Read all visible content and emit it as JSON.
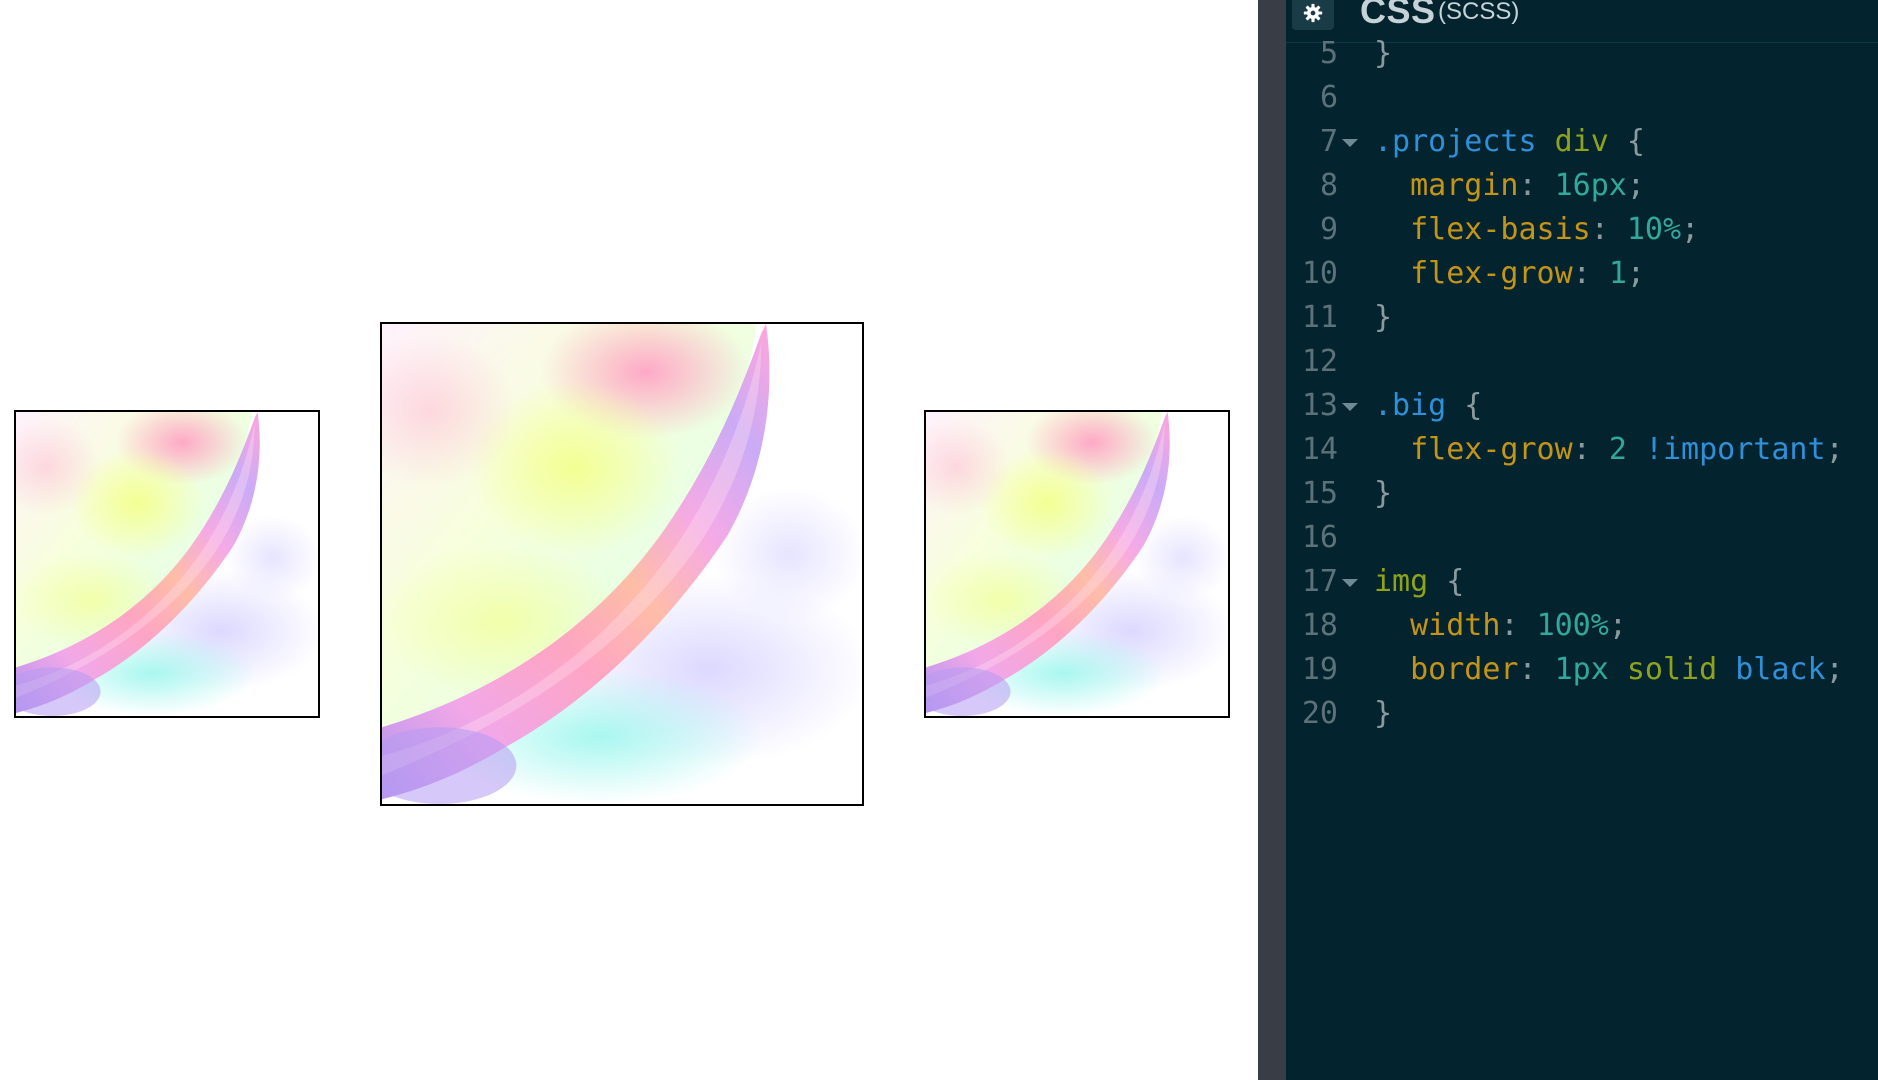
{
  "editor": {
    "language": "CSS",
    "preprocessor": "(SCSS)",
    "settings_icon": "gear-icon",
    "lines": [
      {
        "n": "5",
        "fold": false,
        "tokens": [
          [
            "punct",
            "}"
          ]
        ]
      },
      {
        "n": "6",
        "fold": false,
        "tokens": []
      },
      {
        "n": "7",
        "fold": true,
        "tokens": [
          [
            "sel",
            ".projects"
          ],
          [
            "punct",
            " "
          ],
          [
            "tag",
            "div"
          ],
          [
            "punct",
            " {"
          ]
        ]
      },
      {
        "n": "8",
        "fold": false,
        "tokens": [
          [
            "punct",
            "  "
          ],
          [
            "prop",
            "margin"
          ],
          [
            "punct",
            ": "
          ],
          [
            "num",
            "16px"
          ],
          [
            "punct",
            ";"
          ]
        ]
      },
      {
        "n": "9",
        "fold": false,
        "tokens": [
          [
            "punct",
            "  "
          ],
          [
            "prop",
            "flex-basis"
          ],
          [
            "punct",
            ": "
          ],
          [
            "num",
            "10%"
          ],
          [
            "punct",
            ";"
          ]
        ]
      },
      {
        "n": "10",
        "fold": false,
        "tokens": [
          [
            "punct",
            "  "
          ],
          [
            "prop",
            "flex-grow"
          ],
          [
            "punct",
            ": "
          ],
          [
            "num",
            "1"
          ],
          [
            "punct",
            ";"
          ]
        ]
      },
      {
        "n": "11",
        "fold": false,
        "tokens": [
          [
            "punct",
            "}"
          ]
        ]
      },
      {
        "n": "12",
        "fold": false,
        "tokens": []
      },
      {
        "n": "13",
        "fold": true,
        "tokens": [
          [
            "sel",
            ".big"
          ],
          [
            "punct",
            " {"
          ]
        ]
      },
      {
        "n": "14",
        "fold": false,
        "tokens": [
          [
            "punct",
            "  "
          ],
          [
            "prop",
            "flex-grow"
          ],
          [
            "punct",
            ": "
          ],
          [
            "num",
            "2"
          ],
          [
            "punct",
            " "
          ],
          [
            "imp",
            "!important"
          ],
          [
            "punct",
            ";"
          ]
        ]
      },
      {
        "n": "15",
        "fold": false,
        "tokens": [
          [
            "punct",
            "}"
          ]
        ]
      },
      {
        "n": "16",
        "fold": false,
        "tokens": []
      },
      {
        "n": "17",
        "fold": true,
        "tokens": [
          [
            "tag",
            "img"
          ],
          [
            "punct",
            " {"
          ]
        ]
      },
      {
        "n": "18",
        "fold": false,
        "tokens": [
          [
            "punct",
            "  "
          ],
          [
            "prop",
            "width"
          ],
          [
            "punct",
            ": "
          ],
          [
            "num",
            "100%"
          ],
          [
            "punct",
            ";"
          ]
        ]
      },
      {
        "n": "19",
        "fold": false,
        "tokens": [
          [
            "punct",
            "  "
          ],
          [
            "prop",
            "border"
          ],
          [
            "punct",
            ": "
          ],
          [
            "num",
            "1px"
          ],
          [
            "punct",
            " "
          ],
          [
            "kw",
            "solid"
          ],
          [
            "punct",
            " "
          ],
          [
            "imp",
            "black"
          ],
          [
            "punct",
            ";"
          ]
        ]
      },
      {
        "n": "20",
        "fold": false,
        "tokens": [
          [
            "punct",
            "}"
          ]
        ]
      }
    ]
  },
  "preview": {
    "images": [
      {
        "name": "project-image-left",
        "size": "small"
      },
      {
        "name": "project-image-center",
        "size": "big"
      },
      {
        "name": "project-image-right",
        "size": "small"
      }
    ]
  },
  "colors": {
    "editor_bg": "#03242e",
    "gutter_strip": "#393d45",
    "selector": "#2f8fd8",
    "property": "#c49416",
    "number": "#32a79c",
    "tag": "#8fa31a"
  }
}
